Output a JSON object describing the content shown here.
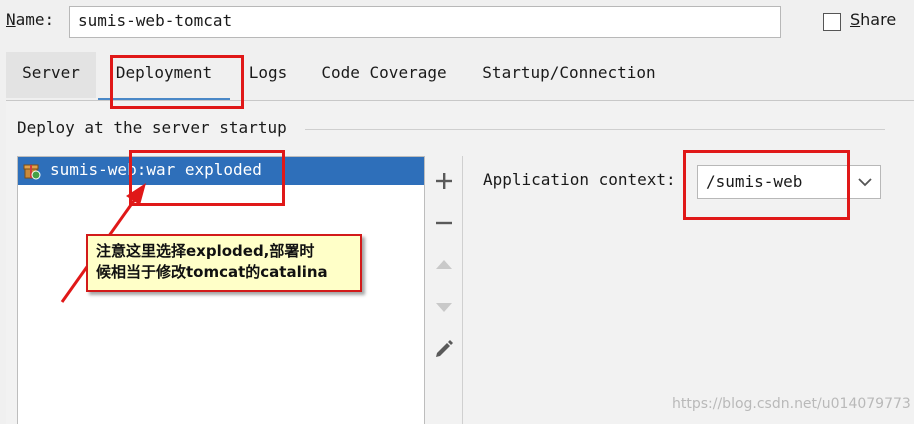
{
  "name_field": {
    "label_underlined": "N",
    "label_rest": "ame:",
    "value": "sumis-web-tomcat"
  },
  "share": {
    "label_underlined": "S",
    "label_rest": "hare",
    "checked": false
  },
  "tabs": [
    {
      "label": "Server"
    },
    {
      "label": "Deployment"
    },
    {
      "label": "Logs"
    },
    {
      "label": "Code Coverage"
    },
    {
      "label": "Startup/Connection"
    }
  ],
  "active_tab": "Deployment",
  "deploy_section": {
    "title": "Deploy at the server startup",
    "items": [
      {
        "label": "sumis-web:war exploded",
        "selected": true
      }
    ]
  },
  "toolbar": {
    "add": "+",
    "remove": "−",
    "move_up": "move-up-icon",
    "move_down": "move-down-icon",
    "edit": "pencil-icon"
  },
  "application_context": {
    "label": "Application context:",
    "value": "/sumis-web"
  },
  "annotation": {
    "line1": "注意这里选择exploded,部署时",
    "line2": "候相当于修改tomcat的catalina"
  },
  "watermark": "https://blog.csdn.net/u014079773",
  "colors": {
    "selection": "#2e6fba",
    "highlight_box": "#e01818",
    "note_bg": "#ffffc8",
    "tab_underline": "#4a88c7"
  }
}
